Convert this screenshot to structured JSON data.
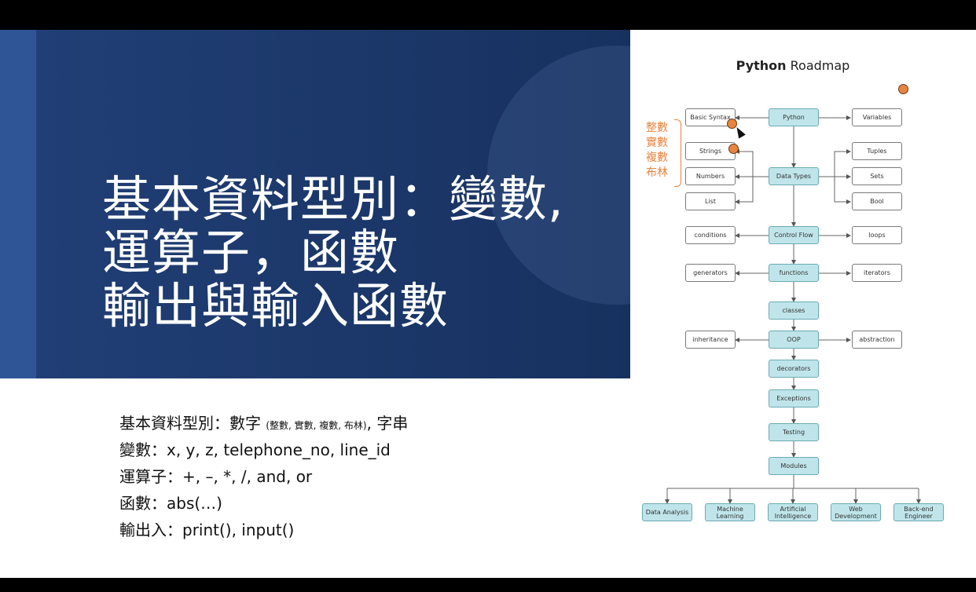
{
  "main_title": [
    "基本資料型別：變數,",
    "運算子，函數",
    "輸出與輸入函數"
  ],
  "bullets": [
    {
      "main": "基本資料型別：數字 ",
      "small": "(整數, 實數, 複數, 布林)",
      "rest": ", 字串"
    },
    {
      "main": "變數：x, y, z, telephone_no, line_id"
    },
    {
      "main": "運算子：+, –, *, /, and, or"
    },
    {
      "main": "函數：abs(…)"
    },
    {
      "main": "輸出入：print(), input()"
    }
  ],
  "roadmap": {
    "title_bold": "Python",
    "title_rest": " Roadmap",
    "nodes": {
      "python": "Python",
      "basic_syntax": "Basic Syntax",
      "variables": "Variables",
      "data_types": "Data Types",
      "strings": "Strings",
      "numbers": "Numbers",
      "list": "List",
      "tuples": "Tuples",
      "sets": "Sets",
      "bool": "Bool",
      "control_flow": "Control Flow",
      "conditions": "conditions",
      "loops": "loops",
      "functions": "functions",
      "generators": "generators",
      "iterators": "iterators",
      "classes": "classes",
      "oop": "OOP",
      "inheritance": "inheritance",
      "abstraction": "abstraction",
      "decorators": "decorators",
      "exceptions": "Exceptions",
      "testing": "Testing",
      "modules": "Modules",
      "data_analysis": "Data Analysis",
      "machine_learning": "Machine Learning",
      "artificial_intelligence": "Artificial Intelligence",
      "web_development": "Web Development",
      "backend_engineer": "Back-end Engineer"
    },
    "number_notes": [
      "整數",
      "實數",
      "複數",
      "布林"
    ],
    "accent_color": "#e8843f",
    "node_color": "#bfe5ea"
  }
}
